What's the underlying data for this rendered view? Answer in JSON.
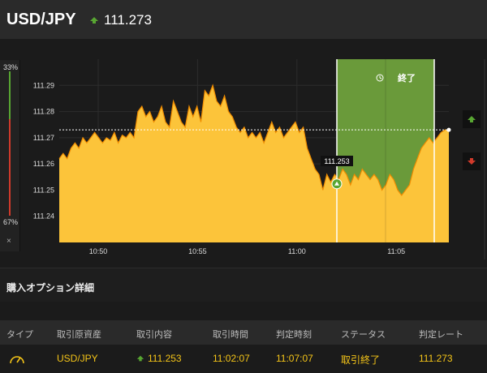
{
  "header": {
    "pair": "USD/JPY",
    "rate": "111.273"
  },
  "sentiment": {
    "up_pct": "33%",
    "down_pct": "67%",
    "up_fraction": 0.33,
    "close": "×"
  },
  "chart": {
    "y_ticks": [
      "111.29",
      "111.28",
      "111.27",
      "111.26",
      "111.25",
      "111.24"
    ],
    "x_ticks": [
      "10:50",
      "10:55",
      "11:00",
      "11:05"
    ],
    "entry_tooltip": "111.253",
    "expiry_label": "終了",
    "current_rate": "111.273"
  },
  "chart_data": {
    "type": "area",
    "ylim": [
      111.23,
      111.3
    ],
    "x_ticks": [
      "10:50",
      "10:55",
      "11:00",
      "11:05"
    ],
    "entry_rate": 111.253,
    "current_rate": 111.273,
    "series": [
      {
        "values": [
          111.262,
          111.264,
          111.262,
          111.266,
          111.268,
          111.266,
          111.27,
          111.268,
          111.27,
          111.272,
          111.27,
          111.268,
          111.27,
          111.269,
          111.272,
          111.268,
          111.271,
          111.27,
          111.272,
          111.27,
          111.28,
          111.282,
          111.278,
          111.28,
          111.276,
          111.278,
          111.282,
          111.276,
          111.274,
          111.284,
          111.28,
          111.276,
          111.274,
          111.282,
          111.278,
          111.282,
          111.276,
          111.288,
          111.286,
          111.29,
          111.284,
          111.282,
          111.286,
          111.28,
          111.278,
          111.274,
          111.272,
          111.274,
          111.27,
          111.272,
          111.27,
          111.272,
          111.268,
          111.272,
          111.276,
          111.272,
          111.274,
          111.27,
          111.272,
          111.274,
          111.276,
          111.272,
          111.274,
          111.266,
          111.262,
          111.258,
          111.256,
          111.25,
          111.256,
          111.253,
          111.256,
          111.254,
          111.258,
          111.256,
          111.252,
          111.256,
          111.254,
          111.258,
          111.256,
          111.254,
          111.256,
          111.254,
          111.25,
          111.252,
          111.256,
          111.254,
          111.25,
          111.248,
          111.25,
          111.252,
          111.258,
          111.262,
          111.266,
          111.268,
          111.27,
          111.268,
          111.27,
          111.272,
          111.273,
          111.273
        ]
      }
    ]
  },
  "section": {
    "title": "購入オプション詳細"
  },
  "table": {
    "headers": [
      "タイプ",
      "取引原資産",
      "取引内容",
      "取引時間",
      "判定時刻",
      "ステータス",
      "判定レート"
    ],
    "row": {
      "type_icon": "gauge-icon",
      "asset": "USD/JPY",
      "content": "111.253",
      "trade_time": "11:02:07",
      "judge_time": "11:07:07",
      "status": "取引終了",
      "judge_rate": "111.273"
    }
  },
  "colors": {
    "area": "#fcc43a",
    "area_stroke": "#f08c00",
    "expiry_zone": "#6a9a3a",
    "up": "#58a632",
    "down": "#d13a2b",
    "accent": "#f5c518"
  }
}
